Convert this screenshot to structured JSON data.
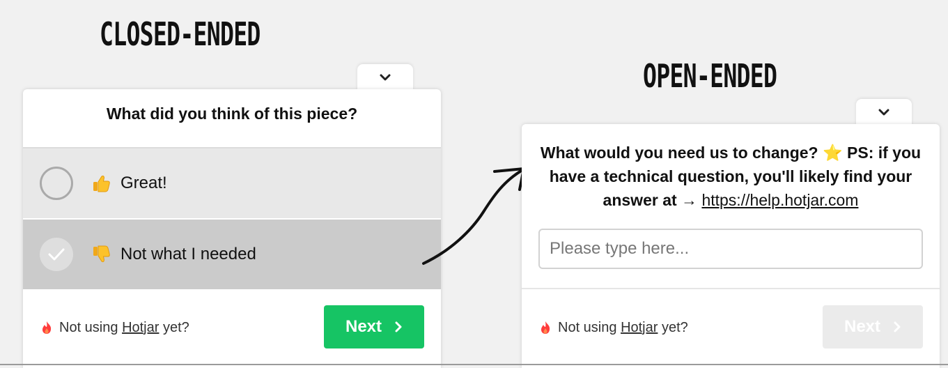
{
  "headings": {
    "closed": "CLOSED-ENDED",
    "open": "OPEN-ENDED"
  },
  "closed_widget": {
    "question": "What did you think of this piece?",
    "options": [
      {
        "label": "Great!",
        "emoji": "thumbs-up-icon",
        "selected": false
      },
      {
        "label": "Not what I needed",
        "emoji": "thumbs-down-icon",
        "selected": true
      }
    ],
    "footer": {
      "prefix": "Not using ",
      "link": "Hotjar",
      "suffix": " yet?"
    },
    "next_label": "Next",
    "next_color": "#16c464"
  },
  "open_widget": {
    "question_text": "What would you need us to change? ⭐ PS: if you have a technical question, you'll likely find your answer at → ",
    "question_url": "https://help.hotjar.com",
    "input_placeholder": "Please type here...",
    "input_value": "",
    "footer": {
      "prefix": "Not using ",
      "link": "Hotjar",
      "suffix": " yet?"
    },
    "next_label": "Next",
    "next_color": "#ebebeb",
    "next_disabled": true
  },
  "icons": [
    "chevron-down-icon",
    "flame-icon",
    "chevron-right-icon",
    "checkmark-icon",
    "curved-arrow-icon"
  ]
}
